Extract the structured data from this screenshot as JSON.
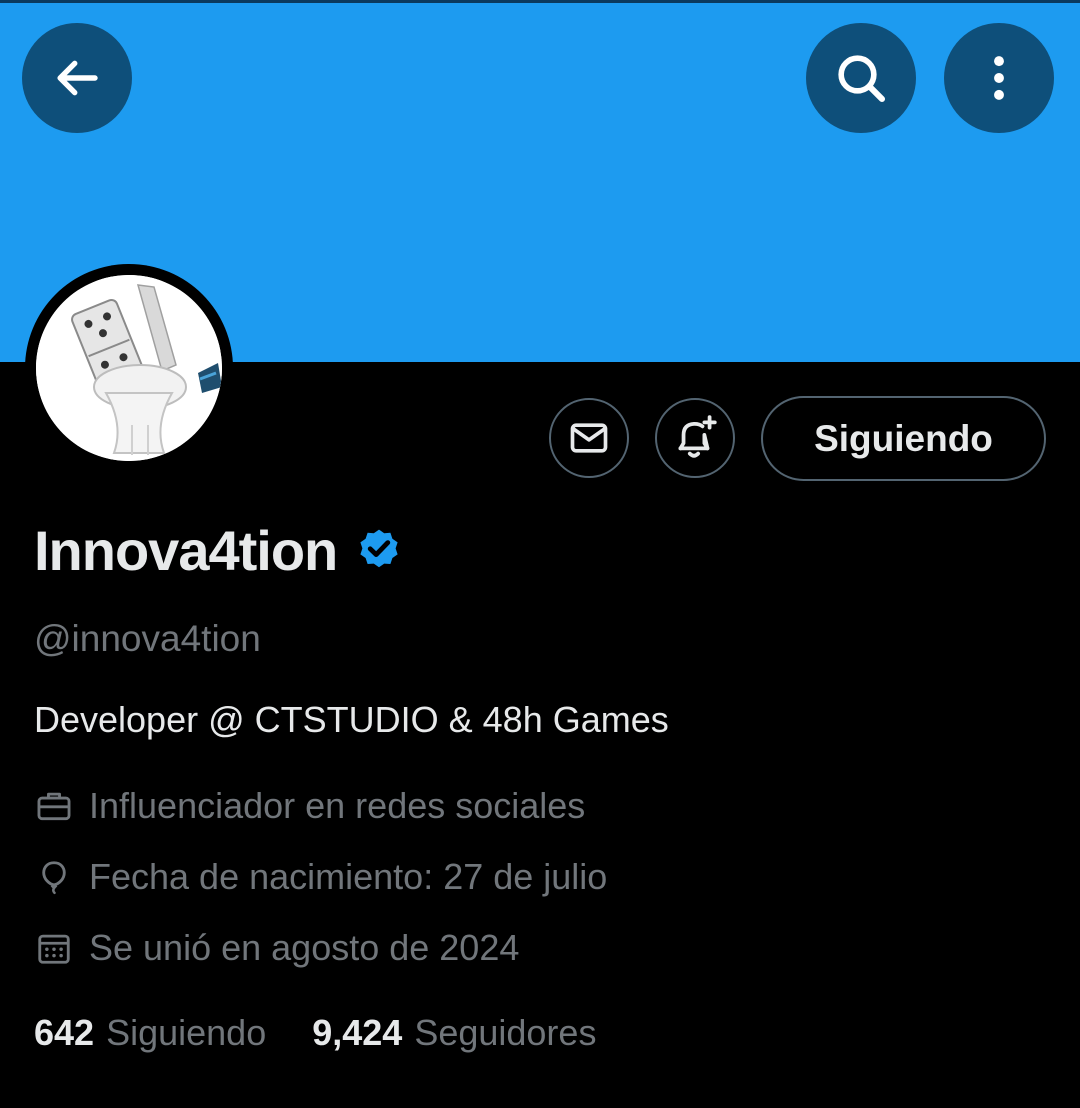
{
  "header": {
    "back_icon": "arrow-left-icon",
    "search_icon": "search-icon",
    "more_icon": "more-vertical-icon",
    "banner_color": "#1d9bf0"
  },
  "profile_actions": {
    "message_icon": "envelope-icon",
    "notify_icon": "bell-plus-icon",
    "follow_label": "Siguiendo"
  },
  "profile": {
    "display_name": "Innova4tion",
    "verified": true,
    "verified_color": "#1d9bf0",
    "handle": "@innova4tion",
    "bio": "Developer @ CTSTUDIO & 48h Games",
    "category": "Influenciador en redes sociales",
    "birthday": "Fecha de nacimiento: 27 de julio",
    "joined": "Se unió en agosto de 2024"
  },
  "stats": {
    "following_count": "642",
    "following_label": "Siguiendo",
    "followers_count": "9,424",
    "followers_label": "Seguidores"
  }
}
